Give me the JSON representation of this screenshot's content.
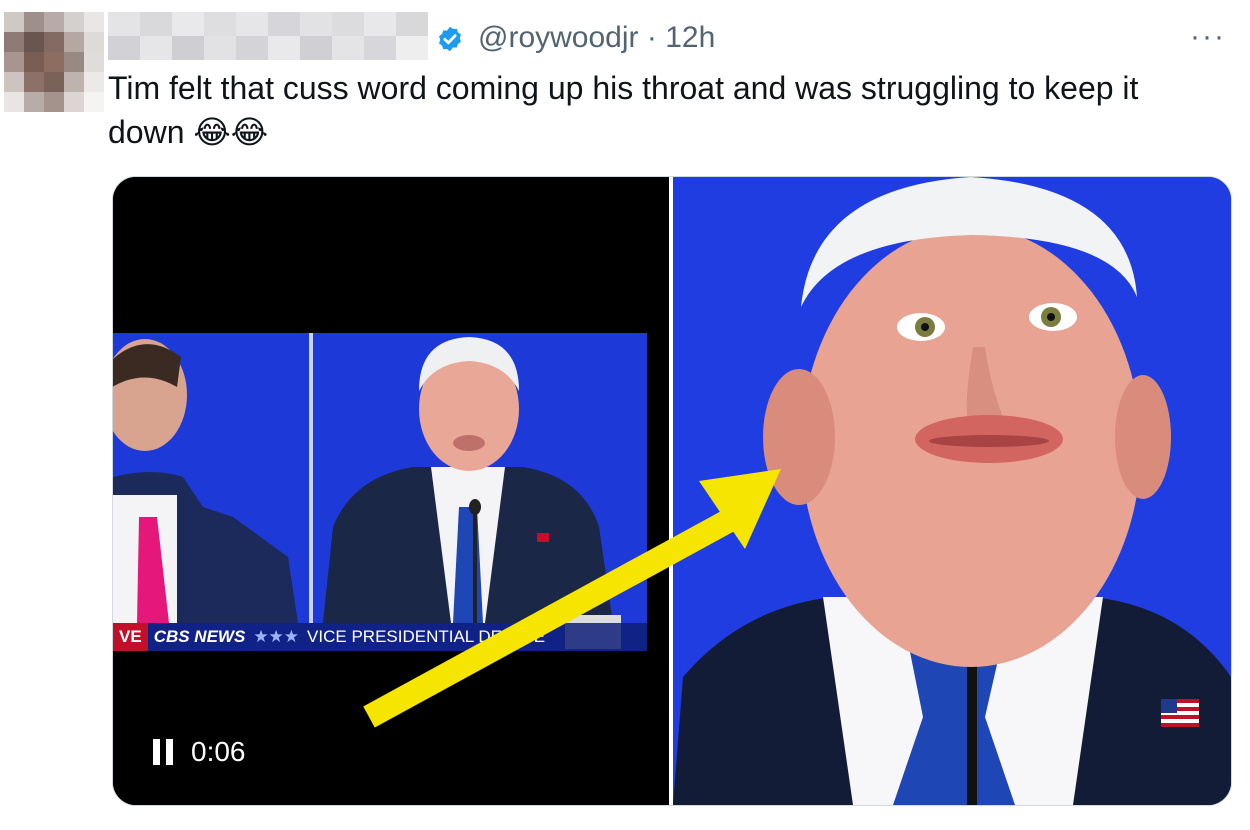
{
  "tweet": {
    "handle": "@roywoodjr",
    "separator": "·",
    "time": "12h",
    "more_label": "···",
    "text": "Tim felt that cuss word coming up his throat and was struggling to keep it down 😂😂"
  },
  "video": {
    "time": "0:06",
    "chyron_live": "VE",
    "chyron_network": "CBS NEWS",
    "chyron_dots": "★★★",
    "chyron_title": "VICE PRESIDENTIAL DEBATE"
  },
  "colors": {
    "verified": "#1d9bf0",
    "arrow": "#f5e500",
    "stage_blue": "#1f3de0"
  },
  "icons": {
    "verified": "verified-badge-icon",
    "pause": "pause-icon",
    "more": "more-icon",
    "arrow": "arrow-icon"
  }
}
